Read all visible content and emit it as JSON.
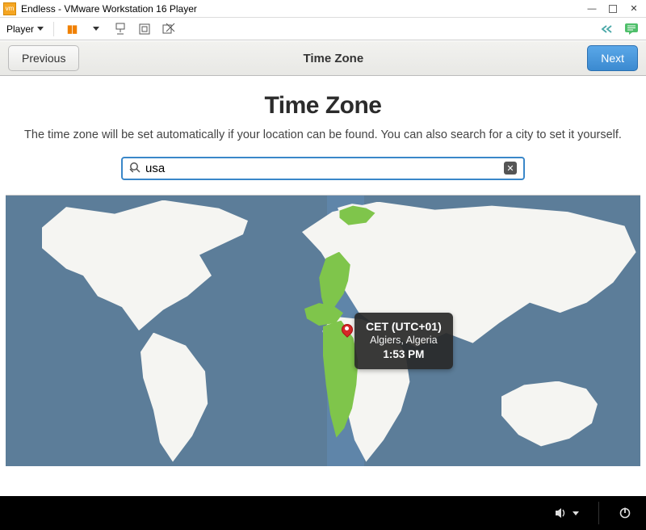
{
  "titlebar": {
    "title": "Endless - VMware Workstation 16 Player"
  },
  "vmtoolbar": {
    "player_label": "Player"
  },
  "setup": {
    "previous_label": "Previous",
    "next_label": "Next",
    "header_title": "Time Zone",
    "page_heading": "Time Zone",
    "description": "The time zone will be set automatically if your location can be found. You can also search for a city to set it yourself."
  },
  "search": {
    "value": "usa",
    "placeholder": ""
  },
  "timezone_tooltip": {
    "tz_label": "CET (UTC+01)",
    "location": "Algiers, Algeria",
    "time": "1:53 PM"
  }
}
